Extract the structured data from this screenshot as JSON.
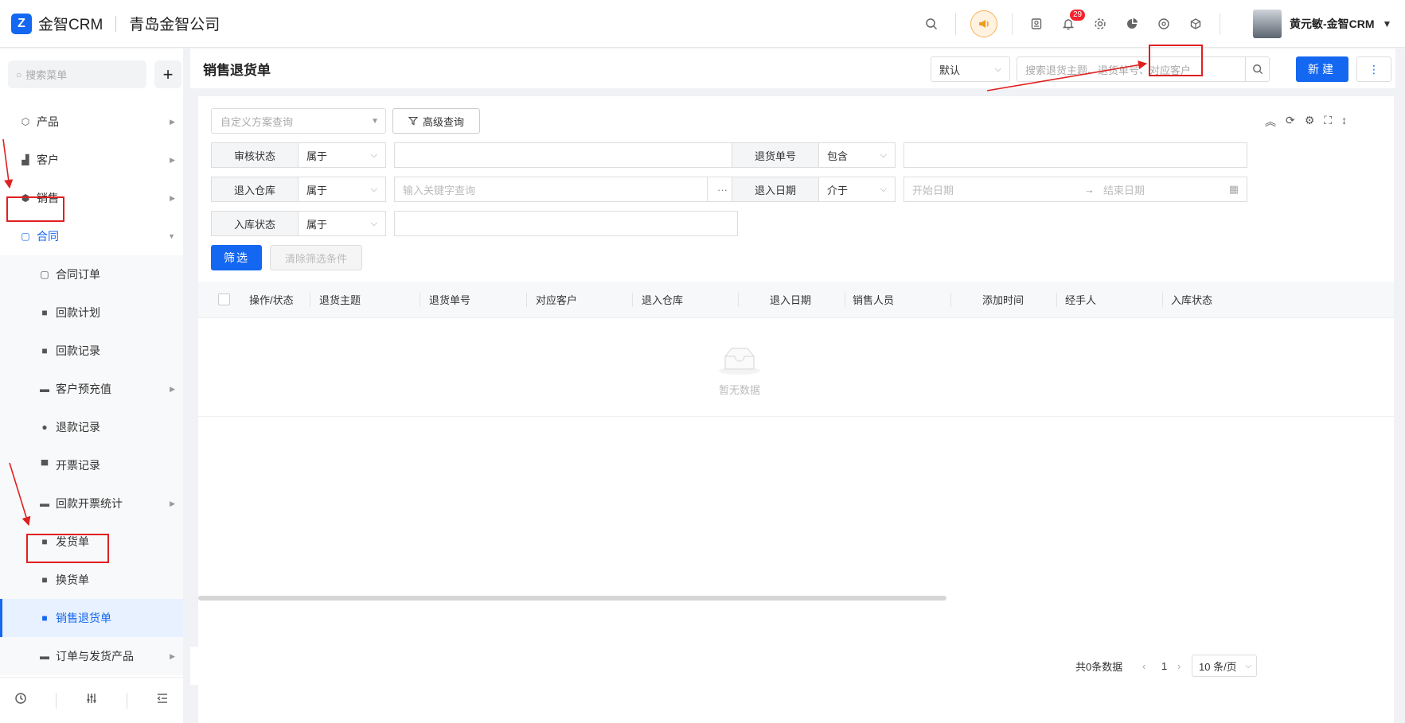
{
  "header": {
    "logo_text": "金智CRM",
    "company": "青岛金智公司",
    "notification_count": "29",
    "user_name": "黄元敏-金智CRM"
  },
  "sidebar": {
    "search_placeholder": "搜索菜单",
    "items": [
      {
        "label": "产品"
      },
      {
        "label": "客户"
      },
      {
        "label": "销售"
      },
      {
        "label": "合同"
      },
      {
        "label": "合同订单"
      },
      {
        "label": "回款计划"
      },
      {
        "label": "回款记录"
      },
      {
        "label": "客户预充值"
      },
      {
        "label": "退款记录"
      },
      {
        "label": "开票记录"
      },
      {
        "label": "回款开票统计"
      },
      {
        "label": "发货单"
      },
      {
        "label": "换货单"
      },
      {
        "label": "销售退货单"
      },
      {
        "label": "订单与发货产品"
      }
    ]
  },
  "page": {
    "title": "销售退货单",
    "view_select": "默认",
    "search_placeholder": "搜索退货主题、退货单号、对应客户",
    "new_button": "新建"
  },
  "filters": {
    "custom_placeholder": "自定义方案查询",
    "advanced_label": "高级查询",
    "rows": [
      {
        "label": "审核状态",
        "op": "属于",
        "placeholder": ""
      },
      {
        "label": "退货单号",
        "op": "包含",
        "placeholder": ""
      },
      {
        "label": "退入仓库",
        "op": "属于",
        "placeholder": "输入关键字查询"
      },
      {
        "label": "退入日期",
        "op": "介于",
        "start": "开始日期",
        "end": "结束日期"
      },
      {
        "label": "入库状态",
        "op": "属于",
        "placeholder": ""
      }
    ],
    "filter_button": "筛选",
    "clear_button": "清除筛选条件"
  },
  "table": {
    "columns": [
      "操作/状态",
      "退货主题",
      "退货单号",
      "对应客户",
      "退入仓库",
      "退入日期",
      "销售人员",
      "添加时间",
      "经手人",
      "入库状态"
    ],
    "empty_text": "暂无数据"
  },
  "pagination": {
    "total": "共0条数据",
    "page": "1",
    "page_size": "10 条/页"
  },
  "colors": {
    "accent": "#1467f0",
    "annotation": "#e02020"
  }
}
